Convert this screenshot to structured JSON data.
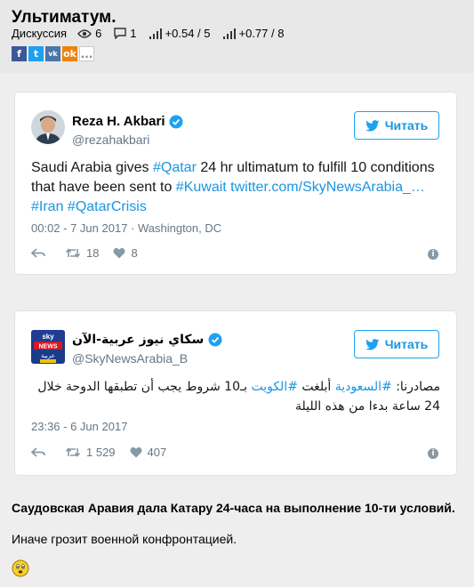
{
  "post": {
    "title": "Ультиматум.",
    "category": "Дискуссия",
    "views": "6",
    "comments": "1",
    "rating1": "+0.54 / 5",
    "rating2": "+0.77 / 8",
    "share": {
      "fb": "f",
      "tw": "t",
      "vk": "vk",
      "ok": "ok",
      "more": "..."
    }
  },
  "tweets": [
    {
      "name": "Reza H. Akbari",
      "handle": "@rezahakbari",
      "follow": "Читать",
      "text_pre": "Saudi Arabia gives ",
      "tag_qatar": "#Qatar",
      "text_mid": " 24 hr ultimatum to fulfill 10 conditions that have been sent to ",
      "tag_kuwait": "#Kuwait",
      "space": " ",
      "link": "twitter.com/SkyNewsArabia_…",
      "tag_iran": "#Iran",
      "tag_crisis": "#QatarCrisis",
      "date": "00:02 - 7 Jun 2017 · Washington, DC",
      "retweets": "18",
      "likes": "8"
    },
    {
      "name": "سكاي نيوز عربية-الآن",
      "handle": "@SkyNewsArabia_B",
      "follow": "Читать",
      "text_a": "مصادرنا: ",
      "tag_saudi": "#السعودية",
      "text_b": " أبلغت ",
      "tag_kuwait": "#الكويت",
      "text_c": " بـ10 شروط يجب أن تطبقها الدوحة خلال 24 ساعة بدءا من هذه الليلة",
      "date": "23:36 - 6 Jun 2017",
      "retweets": "1 529",
      "likes": "407",
      "logo_line1": "sky",
      "logo_line2": "NEWS",
      "logo_line3": "عربية"
    }
  ],
  "body": {
    "para1": "Саудовская Аравия дала Катару 24-часа на выполнение 10-ти условий.",
    "para2": "Иначе грозит военной конфронтацией."
  },
  "colors": {
    "twitter_blue": "#1da1f2",
    "link": "#1b95e0",
    "muted": "#657786"
  }
}
